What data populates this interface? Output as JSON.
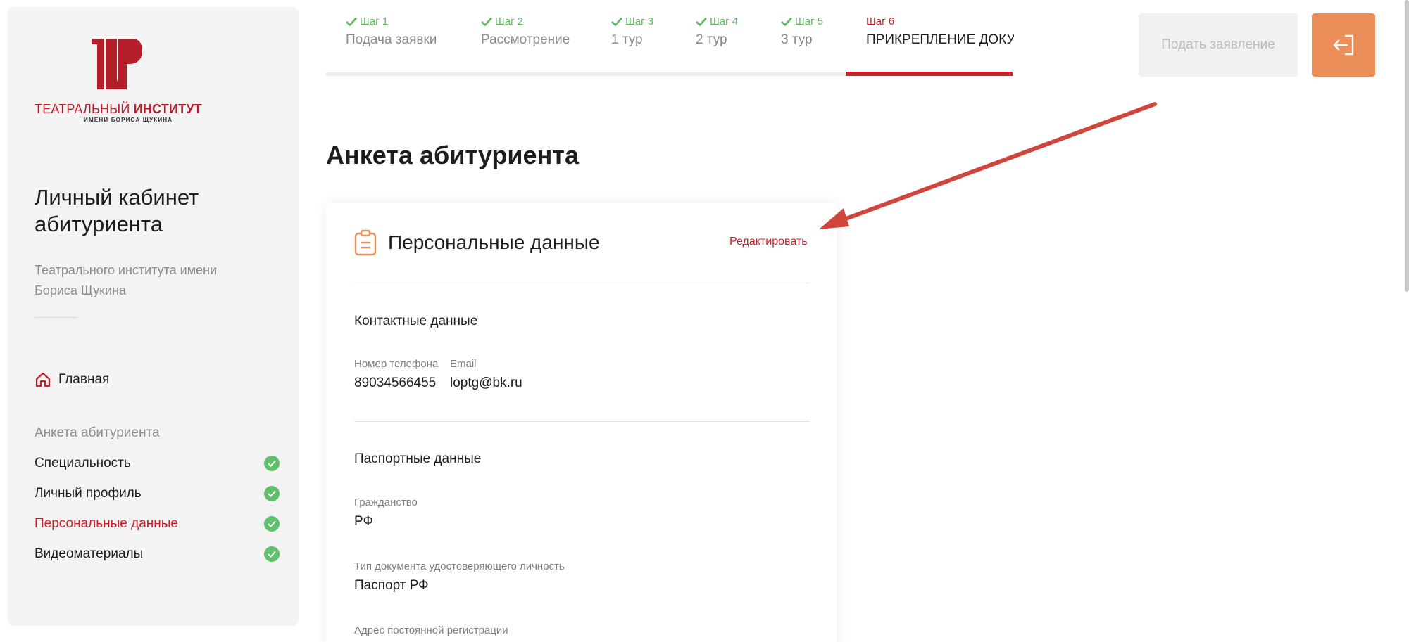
{
  "brand": {
    "line1_a": "ТЕАТРАЛЬНЫЙ ",
    "line1_b": "ИНСТИТУТ",
    "line2": "ИМЕНИ БОРИСА ЩУКИНА",
    "color": "#b41f2a"
  },
  "sidebar": {
    "title": "Личный кабинет абитуриента",
    "subtitle": "Театрального института имени Бориса Щукина",
    "home_label": "Главная",
    "section_label": "Анкета абитуриента",
    "items": [
      {
        "label": "Специальность",
        "done": true,
        "active": false
      },
      {
        "label": "Личный профиль",
        "done": true,
        "active": false
      },
      {
        "label": "Персональные данные",
        "done": true,
        "active": true
      },
      {
        "label": "Видеоматериалы",
        "done": true,
        "active": false
      }
    ]
  },
  "steps": [
    {
      "num": "Шаг 1",
      "name": "Подача заявки",
      "done": true
    },
    {
      "num": "Шаг 2",
      "name": "Рассмотрение",
      "done": true
    },
    {
      "num": "Шаг 3",
      "name": "1 тур",
      "done": true
    },
    {
      "num": "Шаг 4",
      "name": "2 тур",
      "done": true
    },
    {
      "num": "Шаг 5",
      "name": "3 тур",
      "done": true
    },
    {
      "num": "Шаг 6",
      "name": "ПРИКРЕПЛЕНИЕ ДОКУМЕНТОВ",
      "done": false,
      "current": true
    }
  ],
  "header": {
    "submit_label": "Подать заявление",
    "exit_icon": "logout-icon"
  },
  "main": {
    "page_title": "Анкета абитуриента",
    "card": {
      "icon": "clipboard-icon",
      "title": "Персональные данные",
      "edit_label": "Редактировать",
      "contacts": {
        "title": "Контактные данные",
        "phone_label": "Номер телефона",
        "phone_value": "89034566455",
        "email_label": "Email",
        "email_value": "loptg@bk.ru"
      },
      "passport": {
        "title": "Паспортные данные",
        "citizenship_label": "Гражданство",
        "citizenship_value": "РФ",
        "doc_type_label": "Тип документа удостоверяющего личность",
        "doc_type_value": "Паспорт РФ",
        "address_label": "Адрес постоянной регистрации"
      }
    }
  },
  "colors": {
    "accent_red": "#c8202b",
    "success_green": "#5cb85c",
    "exit_orange": "#ec8e58",
    "annotation_arrow": "#d0463c"
  }
}
